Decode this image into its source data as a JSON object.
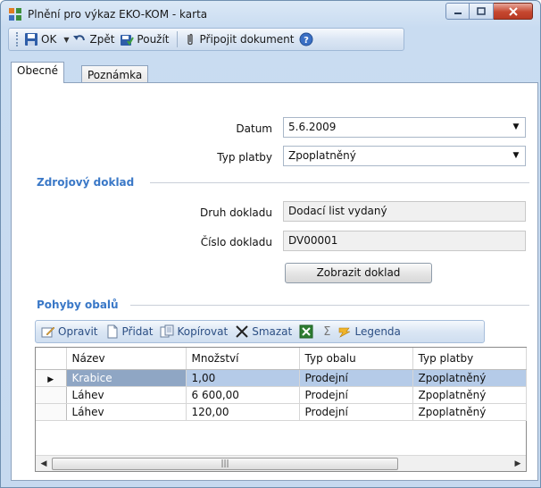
{
  "window": {
    "title": "Plnění pro výkaz EKO-KOM - karta"
  },
  "toolbar": {
    "ok_label": "OK",
    "back_label": "Zpět",
    "apply_label": "Použít",
    "attach_label": "Připojit dokument"
  },
  "tabs": [
    {
      "label": "Obecné",
      "active": true
    },
    {
      "label": "Poznámka",
      "active": false
    }
  ],
  "form": {
    "datum_label": "Datum",
    "datum_value": "5.6.2009",
    "typ_platby_label": "Typ platby",
    "typ_platby_value": "Zpoplatněný"
  },
  "zdrojovy": {
    "section_title": "Zdrojový doklad",
    "druh_label": "Druh dokladu",
    "druh_value": "Dodací list vydaný",
    "cislo_label": "Číslo dokladu",
    "cislo_value": "DV00001",
    "show_button": "Zobrazit doklad"
  },
  "pohyby": {
    "section_title": "Pohyby obalů",
    "toolbar": {
      "edit": "Opravit",
      "add": "Přidat",
      "copy": "Kopírovat",
      "delete": "Smazat",
      "legend": "Legenda"
    },
    "columns": [
      "Název",
      "Množství",
      "Typ obalu",
      "Typ platby"
    ],
    "rows": [
      {
        "nazev": "Krabice",
        "mnozstvi": "1,00",
        "typ_obalu": "Prodejní",
        "typ_platby": "Zpoplatněný",
        "selected": true
      },
      {
        "nazev": "Láhev",
        "mnozstvi": "6 600,00",
        "typ_obalu": "Prodejní",
        "typ_platby": "Zpoplatněný",
        "selected": false
      },
      {
        "nazev": "Láhev",
        "mnozstvi": "120,00",
        "typ_obalu": "Prodejní",
        "typ_platby": "Zpoplatněný",
        "selected": false
      }
    ]
  },
  "colors": {
    "section_heading": "#3a78c7",
    "selected_row": "#b5cbe8",
    "close_button": "#c5472f"
  }
}
